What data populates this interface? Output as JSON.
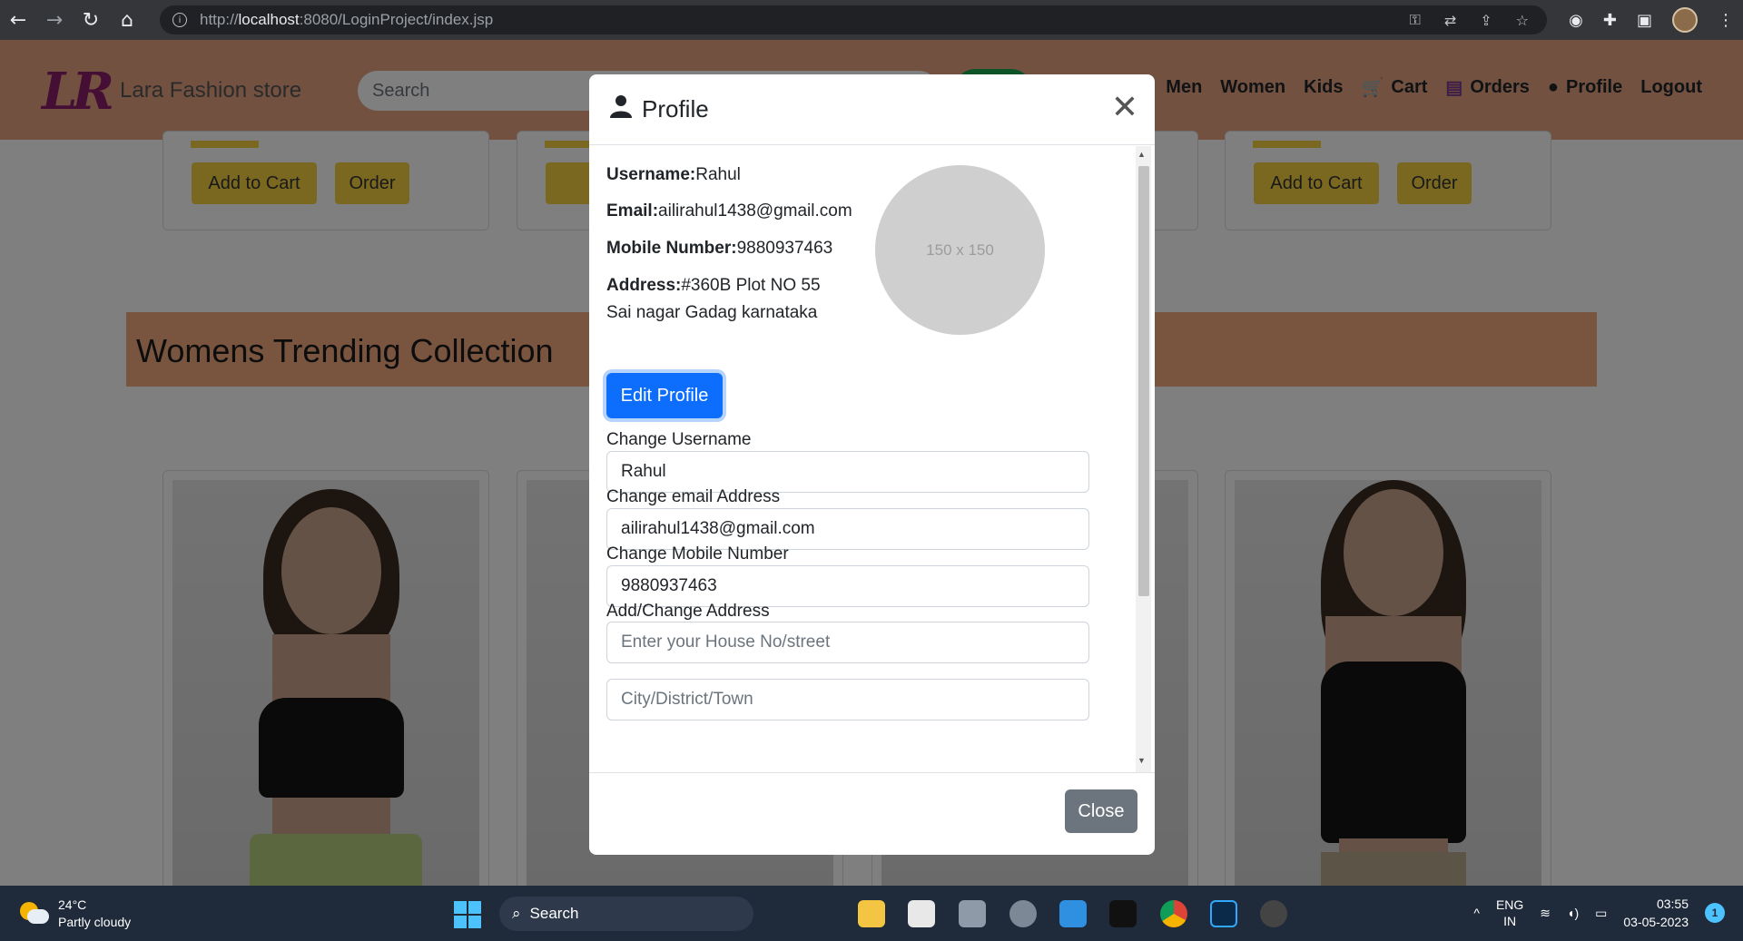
{
  "browser": {
    "url_prefix": "http://",
    "url_host": "localhost",
    "url_rest": ":8080/LoginProject/index.jsp"
  },
  "site": {
    "logo": "LR",
    "brand": "Lara Fashion store",
    "search_placeholder": "Search",
    "menu": [
      "Men",
      "Women",
      "Kids",
      "Cart",
      "Orders",
      "Profile",
      "Logout"
    ],
    "add_to_cart": "Add to Cart",
    "order": "Order",
    "add_truncated": "Add",
    "section_title": "Womens Trending Collection"
  },
  "modal": {
    "title": "Profile",
    "username_label": "Username:",
    "username_value": "Rahul",
    "email_label": "Email:",
    "email_value": "ailirahul1438@gmail.com",
    "mobile_label": "Mobile Number:",
    "mobile_value": "9880937463",
    "address_label": "Address:",
    "address_line1": "#360B Plot NO 55",
    "address_line2": "Sai nagar Gadag karnataka",
    "photo_placeholder": "150 x 150",
    "edit_button": "Edit Profile",
    "change_username_label": "Change Username",
    "change_username_value": "Rahul",
    "change_email_label": "Change email Address",
    "change_email_value": "ailirahul1438@gmail.com",
    "change_mobile_label": "Change Mobile Number",
    "change_mobile_value": "9880937463",
    "address_form_label": "Add/Change Address",
    "street_placeholder": "Enter your House No/street",
    "city_placeholder": "City/District/Town",
    "close_button": "Close"
  },
  "taskbar": {
    "temperature": "24°C",
    "weather": "Partly cloudy",
    "search": "Search",
    "lang1": "ENG",
    "lang2": "IN",
    "time": "03:55",
    "date": "03-05-2023",
    "notifications": "1"
  }
}
